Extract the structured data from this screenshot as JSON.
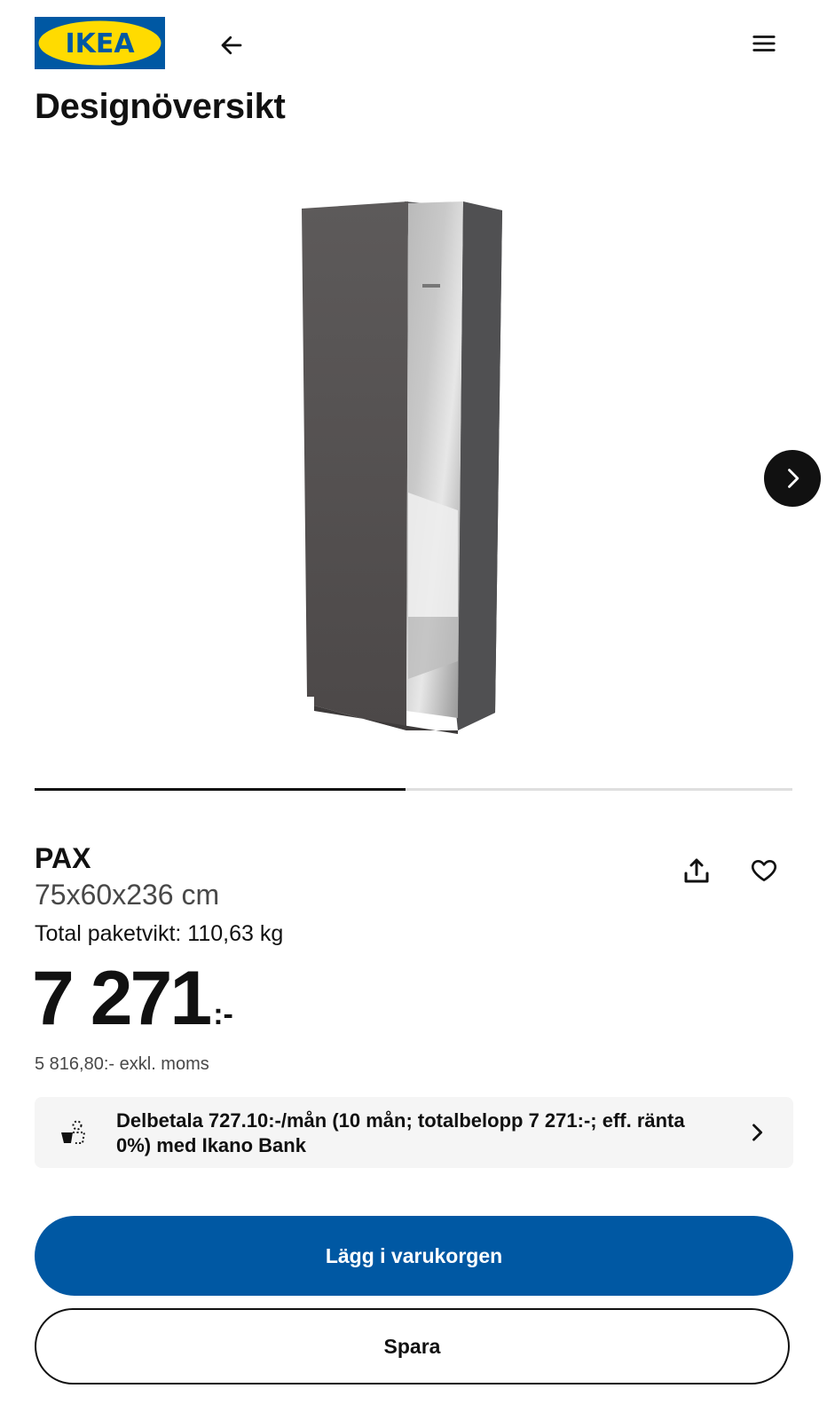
{
  "header": {
    "logo_text": "IKEA",
    "logo_colors": {
      "blue": "#0058a3",
      "yellow": "#ffdb00"
    },
    "back_icon": "arrow-left-icon",
    "menu_icon": "hamburger-menu-icon"
  },
  "page_title": "Designöversikt",
  "carousel": {
    "next_icon": "chevron-right-icon",
    "progress_fraction": 0.49
  },
  "product": {
    "name": "PAX",
    "dimensions": "75x60x236 cm",
    "weight": "Total paketvikt: 110,63 kg",
    "price_integer": "7 271",
    "price_suffix": ":-",
    "price_exkl_moms": "5 816,80:- exkl. moms",
    "share_icon": "share-upload-icon",
    "favorite_icon": "heart-outline-icon"
  },
  "financing": {
    "icon": "installment-payment-icon",
    "text": "Delbetala 727.10:-/mån (10 mån; totalbelopp 7 271:-; eff. ränta 0%) med Ikano Bank",
    "chevron_icon": "chevron-right-icon"
  },
  "actions": {
    "add_to_cart_label": "Lägg i varukorgen",
    "save_label": "Spara",
    "primary_color": "#0058a3"
  }
}
